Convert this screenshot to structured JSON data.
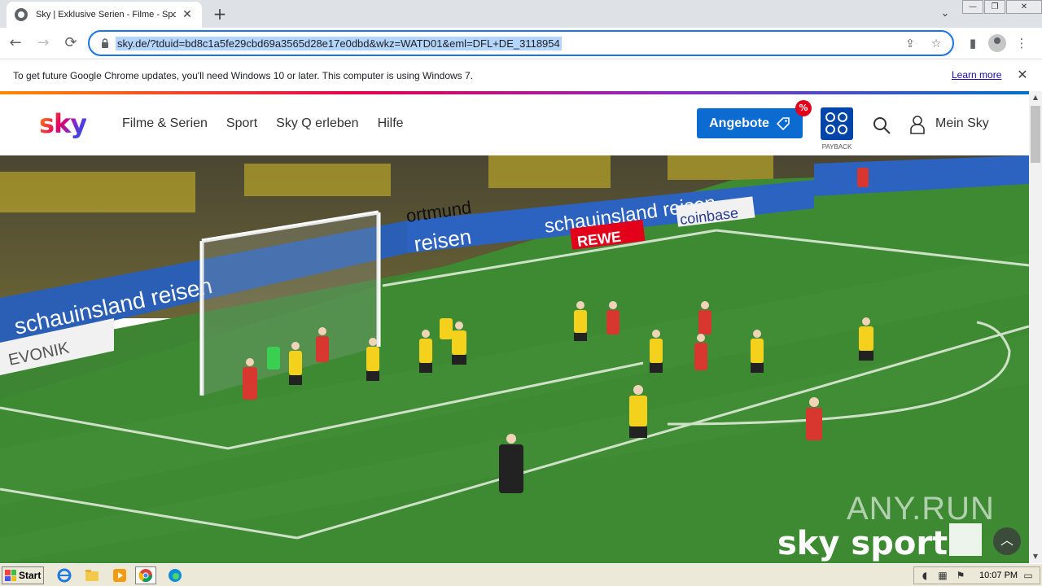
{
  "browser": {
    "tab_title": "Sky | Exklusive Serien - Filme - Sport",
    "tab_close": "✕",
    "new_tab": "+",
    "tab_search": "⌄",
    "window_buttons": [
      "—",
      "❐",
      "✕"
    ],
    "url": "sky.de/?tduid=bd8c1a5fe29cbd69a3565d28e17e0dbd&wkz=WATD01&eml=DFL+DE_3118954",
    "nav": {
      "back": "←",
      "forward": "→",
      "reload": "⟳"
    },
    "omnibox_icons": {
      "share": "⇪",
      "bookmark": "☆"
    },
    "toolbar_icons": {
      "sidepanel": "▮",
      "menu": "⋮"
    }
  },
  "infobar": {
    "message": "To get future Google Chrome updates, you'll need Windows 10 or later. This computer is using Windows 7.",
    "link": "Learn more",
    "close": "✕"
  },
  "sky": {
    "logo": "sky",
    "nav_items": [
      "Filme & Serien",
      "Sport",
      "Sky Q erleben",
      "Hilfe"
    ],
    "offer_button": "Angebote",
    "offer_badge": "%",
    "payback_label": "PAYBACK",
    "account_label": "Mein Sky"
  },
  "video": {
    "sponsor_boards": [
      "schauinsland reisen",
      "schauinsland reisen",
      "coinbase",
      "EVONIK",
      "ortmund",
      "reisen",
      "REWE"
    ],
    "broadcaster_logo": "sky sport",
    "watermark": "ANY.RUN",
    "scroll_top": "︿"
  },
  "taskbar": {
    "start": "Start",
    "clock": "10:07 PM"
  }
}
